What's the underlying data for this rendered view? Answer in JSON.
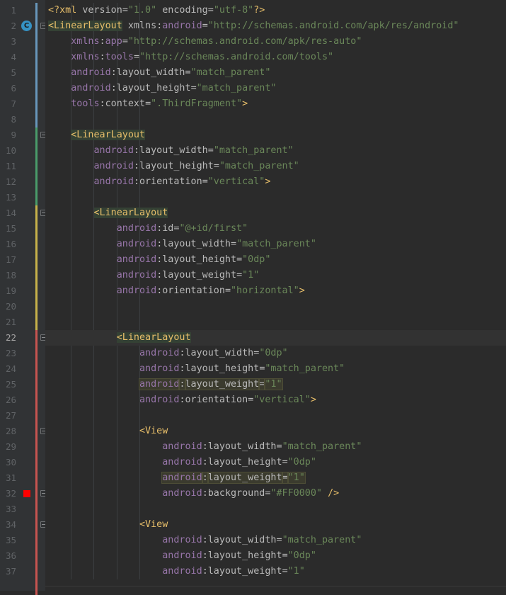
{
  "editor": {
    "current_line": "22",
    "lines": [
      {
        "num": "1",
        "tokens": [
          [
            "pi",
            "<?xml "
          ],
          [
            "attr",
            "version"
          ],
          [
            "plain",
            "="
          ],
          [
            "val",
            "\"1.0\""
          ],
          [
            "plain",
            " "
          ],
          [
            "attr",
            "encoding"
          ],
          [
            "plain",
            "="
          ],
          [
            "val",
            "\"utf-8\""
          ],
          [
            "pi",
            "?>"
          ]
        ]
      },
      {
        "num": "2",
        "tokens": [
          [
            "tag-hl",
            "<LinearLayout"
          ],
          [
            "plain",
            " "
          ],
          [
            "attr",
            "xmlns"
          ],
          [
            "plain",
            ":"
          ],
          [
            "ns",
            "android"
          ],
          [
            "plain",
            "="
          ],
          [
            "val",
            "\"http://schemas.android.com/apk/res/android\""
          ]
        ]
      },
      {
        "num": "3",
        "tokens": [
          [
            "ns",
            "    xmlns"
          ],
          [
            "plain",
            ":"
          ],
          [
            "ns",
            "app"
          ],
          [
            "plain",
            "="
          ],
          [
            "val",
            "\"http://schemas.android.com/apk/res-auto\""
          ]
        ]
      },
      {
        "num": "4",
        "tokens": [
          [
            "ns",
            "    xmlns"
          ],
          [
            "plain",
            ":"
          ],
          [
            "ns",
            "tools"
          ],
          [
            "plain",
            "="
          ],
          [
            "val",
            "\"http://schemas.android.com/tools\""
          ]
        ]
      },
      {
        "num": "5",
        "tokens": [
          [
            "ns",
            "    android"
          ],
          [
            "plain",
            ":"
          ],
          [
            "attr",
            "layout_width"
          ],
          [
            "plain",
            "="
          ],
          [
            "val",
            "\"match_parent\""
          ]
        ]
      },
      {
        "num": "6",
        "tokens": [
          [
            "ns",
            "    android"
          ],
          [
            "plain",
            ":"
          ],
          [
            "attr",
            "layout_height"
          ],
          [
            "plain",
            "="
          ],
          [
            "val",
            "\"match_parent\""
          ]
        ]
      },
      {
        "num": "7",
        "tokens": [
          [
            "ns",
            "    tools"
          ],
          [
            "plain",
            ":"
          ],
          [
            "attr",
            "context"
          ],
          [
            "plain",
            "="
          ],
          [
            "val",
            "\".ThirdFragment\""
          ],
          [
            "tag",
            ">"
          ]
        ]
      },
      {
        "num": "8",
        "tokens": []
      },
      {
        "num": "9",
        "tokens": [
          [
            "plain",
            "    "
          ],
          [
            "tag-hl",
            "<LinearLayout"
          ]
        ]
      },
      {
        "num": "10",
        "tokens": [
          [
            "ns",
            "        android"
          ],
          [
            "plain",
            ":"
          ],
          [
            "attr",
            "layout_width"
          ],
          [
            "plain",
            "="
          ],
          [
            "val",
            "\"match_parent\""
          ]
        ]
      },
      {
        "num": "11",
        "tokens": [
          [
            "ns",
            "        android"
          ],
          [
            "plain",
            ":"
          ],
          [
            "attr",
            "layout_height"
          ],
          [
            "plain",
            "="
          ],
          [
            "val",
            "\"match_parent\""
          ]
        ]
      },
      {
        "num": "12",
        "tokens": [
          [
            "ns",
            "        android"
          ],
          [
            "plain",
            ":"
          ],
          [
            "attr",
            "orientation"
          ],
          [
            "plain",
            "="
          ],
          [
            "val",
            "\"vertical\""
          ],
          [
            "tag",
            ">"
          ]
        ]
      },
      {
        "num": "13",
        "tokens": []
      },
      {
        "num": "14",
        "tokens": [
          [
            "plain",
            "        "
          ],
          [
            "tag-hl",
            "<LinearLayout"
          ]
        ]
      },
      {
        "num": "15",
        "tokens": [
          [
            "ns",
            "            android"
          ],
          [
            "plain",
            ":"
          ],
          [
            "attr",
            "id"
          ],
          [
            "plain",
            "="
          ],
          [
            "val",
            "\"@+id/first\""
          ]
        ]
      },
      {
        "num": "16",
        "tokens": [
          [
            "ns",
            "            android"
          ],
          [
            "plain",
            ":"
          ],
          [
            "attr",
            "layout_width"
          ],
          [
            "plain",
            "="
          ],
          [
            "val",
            "\"match_parent\""
          ]
        ]
      },
      {
        "num": "17",
        "tokens": [
          [
            "ns",
            "            android"
          ],
          [
            "plain",
            ":"
          ],
          [
            "attr",
            "layout_height"
          ],
          [
            "plain",
            "="
          ],
          [
            "val",
            "\"0dp\""
          ]
        ]
      },
      {
        "num": "18",
        "tokens": [
          [
            "ns",
            "            android"
          ],
          [
            "plain",
            ":"
          ],
          [
            "attr",
            "layout_weight"
          ],
          [
            "plain",
            "="
          ],
          [
            "val",
            "\"1\""
          ]
        ]
      },
      {
        "num": "19",
        "tokens": [
          [
            "ns",
            "            android"
          ],
          [
            "plain",
            ":"
          ],
          [
            "attr",
            "orientation"
          ],
          [
            "plain",
            "="
          ],
          [
            "val",
            "\"horizontal\""
          ],
          [
            "tag",
            ">"
          ]
        ]
      },
      {
        "num": "20",
        "tokens": []
      },
      {
        "num": "21",
        "tokens": []
      },
      {
        "num": "22",
        "tokens": [
          [
            "plain",
            "            "
          ],
          [
            "tag-hl",
            "<LinearLayout"
          ]
        ]
      },
      {
        "num": "23",
        "tokens": [
          [
            "ns",
            "                android"
          ],
          [
            "plain",
            ":"
          ],
          [
            "attr",
            "layout_width"
          ],
          [
            "plain",
            "="
          ],
          [
            "val",
            "\"0dp\""
          ]
        ]
      },
      {
        "num": "24",
        "tokens": [
          [
            "ns",
            "                android"
          ],
          [
            "plain",
            ":"
          ],
          [
            "attr",
            "layout_height"
          ],
          [
            "plain",
            "="
          ],
          [
            "val",
            "\"match_parent\""
          ]
        ]
      },
      {
        "num": "25",
        "tokens": [
          [
            "plain",
            "                "
          ],
          [
            "ns-hl",
            "android"
          ],
          [
            "plain-hl",
            ":"
          ],
          [
            "attr-hl",
            "layout_weight"
          ],
          [
            "plain-hl",
            "="
          ],
          [
            "val-hl",
            "\"1\""
          ]
        ]
      },
      {
        "num": "26",
        "tokens": [
          [
            "ns",
            "                android"
          ],
          [
            "plain",
            ":"
          ],
          [
            "attr",
            "orientation"
          ],
          [
            "plain",
            "="
          ],
          [
            "val",
            "\"vertical\""
          ],
          [
            "tag",
            ">"
          ]
        ]
      },
      {
        "num": "27",
        "tokens": []
      },
      {
        "num": "28",
        "tokens": [
          [
            "plain",
            "                "
          ],
          [
            "tag",
            "<View"
          ]
        ]
      },
      {
        "num": "29",
        "tokens": [
          [
            "ns",
            "                    android"
          ],
          [
            "plain",
            ":"
          ],
          [
            "attr",
            "layout_width"
          ],
          [
            "plain",
            "="
          ],
          [
            "val",
            "\"match_parent\""
          ]
        ]
      },
      {
        "num": "30",
        "tokens": [
          [
            "ns",
            "                    android"
          ],
          [
            "plain",
            ":"
          ],
          [
            "attr",
            "layout_height"
          ],
          [
            "plain",
            "="
          ],
          [
            "val",
            "\"0dp\""
          ]
        ]
      },
      {
        "num": "31",
        "tokens": [
          [
            "plain",
            "                    "
          ],
          [
            "ns-hl",
            "android"
          ],
          [
            "plain-hl",
            ":"
          ],
          [
            "attr-hl",
            "layout_weight"
          ],
          [
            "plain-hl",
            "="
          ],
          [
            "val-hl",
            "\"1\""
          ]
        ]
      },
      {
        "num": "32",
        "tokens": [
          [
            "ns",
            "                    android"
          ],
          [
            "plain",
            ":"
          ],
          [
            "attr",
            "background"
          ],
          [
            "plain",
            "="
          ],
          [
            "val",
            "\"#FF0000\""
          ],
          [
            "plain",
            " "
          ],
          [
            "tag",
            "/>"
          ]
        ]
      },
      {
        "num": "33",
        "tokens": []
      },
      {
        "num": "34",
        "tokens": [
          [
            "plain",
            "                "
          ],
          [
            "tag",
            "<View"
          ]
        ]
      },
      {
        "num": "35",
        "tokens": [
          [
            "ns",
            "                    android"
          ],
          [
            "plain",
            ":"
          ],
          [
            "attr",
            "layout_width"
          ],
          [
            "plain",
            "="
          ],
          [
            "val",
            "\"match_parent\""
          ]
        ]
      },
      {
        "num": "36",
        "tokens": [
          [
            "ns",
            "                    android"
          ],
          [
            "plain",
            ":"
          ],
          [
            "attr",
            "layout_height"
          ],
          [
            "plain",
            "="
          ],
          [
            "val",
            "\"0dp\""
          ]
        ]
      },
      {
        "num": "37",
        "tokens": [
          [
            "ns",
            "                    android"
          ],
          [
            "plain",
            ":"
          ],
          [
            "attr",
            "layout_weight"
          ],
          [
            "plain",
            "="
          ],
          [
            "val",
            "\"1\""
          ]
        ]
      }
    ],
    "gutter_icons": {
      "class_badge": {
        "line": "2",
        "label": "C"
      },
      "color_swatch": {
        "line": "32",
        "color": "#FF0000"
      }
    },
    "fold_lines": [
      "2",
      "9",
      "14",
      "22",
      "28",
      "32",
      "34"
    ],
    "colors": {
      "background": "#2b2b2b",
      "gutter": "#313335",
      "tag": "#e8bf6a",
      "namespace": "#9876aa",
      "attribute": "#bababa",
      "value": "#6a8759",
      "change_added": "#4a9c6a",
      "change_modified": "#6897bb",
      "change_yellow": "#c7b24a",
      "change_red": "#c75450"
    }
  }
}
